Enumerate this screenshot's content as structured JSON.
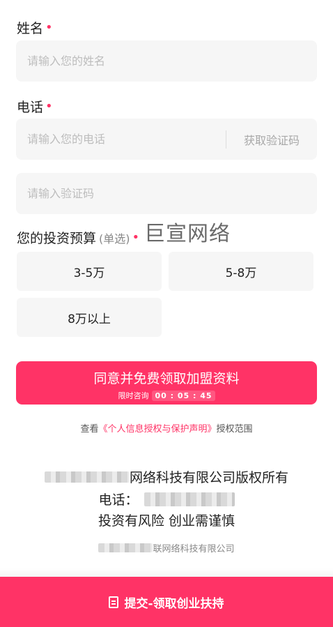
{
  "form": {
    "name_label": "姓名",
    "required_mark": "•",
    "name_placeholder": "请输入您的姓名",
    "phone_label": "电话",
    "phone_placeholder": "请输入您的电话",
    "get_code_label": "获取验证码",
    "code_placeholder": "请输入验证码",
    "budget_label": "您的投资预算",
    "budget_hint": "(单选)",
    "budget_options": [
      "3-5万",
      "5-8万",
      "8万以上"
    ]
  },
  "watermark": "巨宣网络",
  "cta": {
    "title": "同意并免费领取加盟资料",
    "timer_label": "限时咨询",
    "timer_value": "00 : 05 : 45"
  },
  "agreement": {
    "prefix": "查看",
    "link": "《个人信息授权与保护声明》",
    "suffix": "授权范围"
  },
  "footer": {
    "company_suffix": "网络科技有限公司版权所有",
    "phone_label": "电话：",
    "risk_notice": "投资有风险 创业需谨慎",
    "small_company_suffix": "联网络科技有限公司"
  },
  "bottom_bar": {
    "label": "提交-领取创业扶持",
    "icon": "document-icon"
  },
  "colors": {
    "accent": "#ff3366",
    "field_bg": "#f6f6f6"
  }
}
